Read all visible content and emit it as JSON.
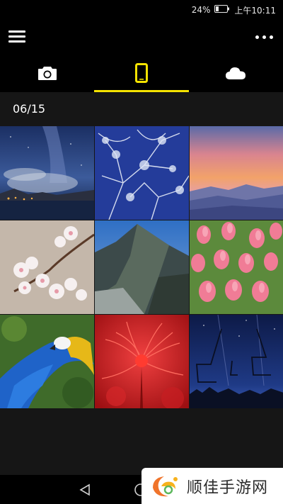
{
  "status_bar": {
    "battery": "24%",
    "time": "上午10:11"
  },
  "app_bar": {
    "menu_icon": "hamburger-menu-icon",
    "overflow_icon": "more-dots-icon"
  },
  "tabs": [
    {
      "icon": "camera-icon",
      "active": false
    },
    {
      "icon": "phone-icon",
      "active": true
    },
    {
      "icon": "cloud-icon",
      "active": false
    }
  ],
  "accent_color": "#f5e300",
  "gallery": {
    "date": "06/15",
    "photos": [
      "milky-way-lake-night",
      "frosted-trees-blue-sky",
      "sunset-mountain-haze",
      "cherry-blossoms",
      "rocky-mountain-peak",
      "pink-tulips",
      "blue-yellow-macaw",
      "red-spider-lily",
      "chairlift-night-sky"
    ]
  },
  "nav": {
    "back_icon": "back-triangle-icon",
    "home_icon": "home-circle-icon"
  },
  "watermark": {
    "text": "顺佳手游网"
  }
}
